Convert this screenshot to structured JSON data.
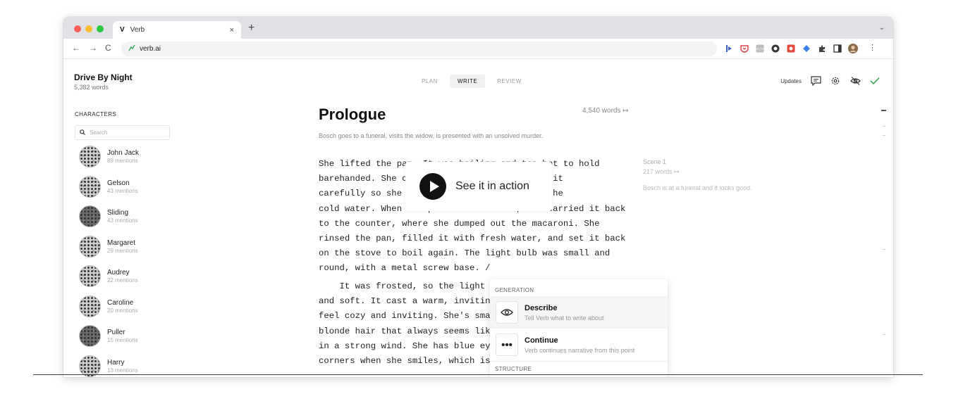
{
  "browser": {
    "tab_favicon": "V",
    "tab_title": "Verb",
    "tab_close": "×",
    "new_tab": "+",
    "tab_menu": "⌄",
    "back": "←",
    "forward": "→",
    "reload": "C",
    "url": "verb.ai",
    "menu": "⋮",
    "traffic_colors": {
      "red": "#ff5f57",
      "yellow": "#febc2e",
      "green": "#28c840"
    }
  },
  "header": {
    "doc_title": "Drive By Night",
    "doc_words": "5,382 words",
    "modes": [
      {
        "label": "PLAN",
        "active": false
      },
      {
        "label": "WRITE",
        "active": true
      },
      {
        "label": "REVIEW",
        "active": false
      }
    ],
    "updates_label": "Updates",
    "accent": "#35a854"
  },
  "sidebar": {
    "heading": "CHARACTERS",
    "search_placeholder": "Search",
    "characters": [
      {
        "name": "John Jack",
        "mentions": "89 mentions"
      },
      {
        "name": "Gelson",
        "mentions": "43 mentions"
      },
      {
        "name": "Sliding",
        "mentions": "43 mentions"
      },
      {
        "name": "Margaret",
        "mentions": "29 mentions"
      },
      {
        "name": "Audrey",
        "mentions": "22 mentions"
      },
      {
        "name": "Caroline",
        "mentions": "20 mentions"
      },
      {
        "name": "Puller",
        "mentions": "15 mentions"
      },
      {
        "name": "Harry",
        "mentions": "13 mentions"
      }
    ]
  },
  "editor": {
    "chapter_title": "Prologue",
    "chapter_words": "4,540 words ↦",
    "chapter_summary": "Bosch goes to a funeral, visits the widow, is presented with an unsolved murder.",
    "paragraph1": [
      "She lifted the pan. It was boiling and too hot to hold",
      "barehanded. She carried it over, positioning it",
      "carefully so she could reach. She turned on the",
      "cold water. When the pan was half full, she carried it back",
      "to the counter, where she dumped out the macaroni. She",
      "rinsed the pan, filled it with fresh water, and set it back",
      "on the stove to boil again. The light bulb was small and",
      "round, with a metal screw base. /"
    ],
    "paragraph2": [
      "    It was frosted, so the light",
      "and soft. It cast a warm, inviting",
      "feel cozy and inviting. She's small",
      "blonde hair that always seems like",
      "in a strong wind. She has blue eyes",
      "corners when she smiles, which is"
    ]
  },
  "scene": {
    "label": "Scene 1",
    "words": "217 words ↦",
    "summary": "Bosch is at a funeral and it looks good."
  },
  "video": {
    "label": "See it in action"
  },
  "popup": {
    "section_generation": "GENERATION",
    "items": [
      {
        "icon": "eye-icon",
        "title": "Describe",
        "desc": "Tell Verb what to write about"
      },
      {
        "icon": "ellipsis-icon",
        "glyph": "•••",
        "title": "Continue",
        "desc": "Verb continues narrative from this point"
      }
    ],
    "section_structure": "STRUCTURE"
  }
}
